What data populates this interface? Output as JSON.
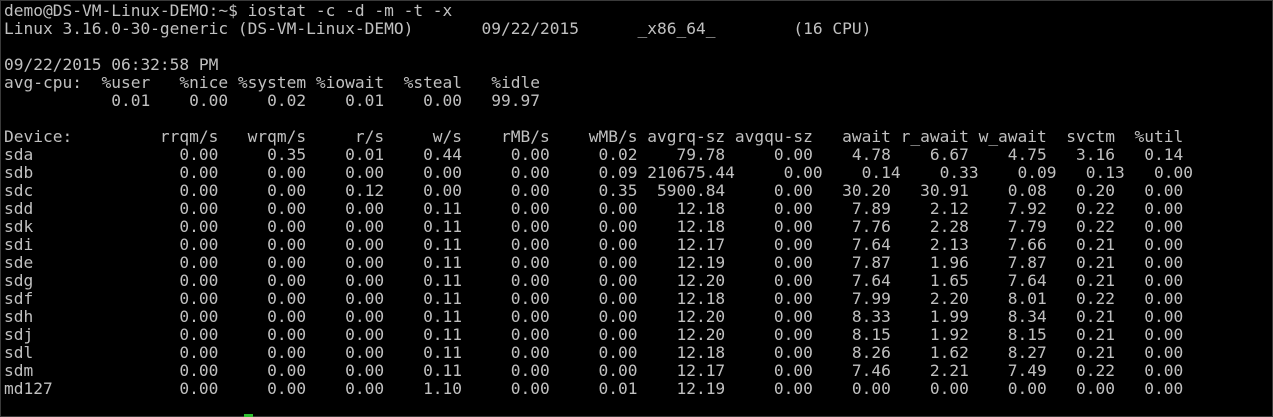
{
  "terminal": {
    "lines": [
      "demo@DS-VM-Linux-DEMO:~$ iostat -c -d -m -t -x",
      "Linux 3.16.0-30-generic (DS-VM-Linux-DEMO)       09/22/2015      _x86_64_        (16 CPU)",
      "",
      "09/22/2015 06:32:58 PM",
      "avg-cpu:  %user   %nice %system %iowait  %steal   %idle",
      "           0.01    0.00    0.02    0.01    0.00   99.97",
      "",
      "Device:         rrqm/s   wrqm/s     r/s     w/s    rMB/s    wMB/s avgrq-sz avgqu-sz   await r_await w_await  svctm  %util",
      "sda               0.00     0.35    0.01    0.44     0.00     0.02    79.78     0.00    4.78    6.67    4.75   3.16   0.14",
      "sdb               0.00     0.00    0.00    0.00     0.00     0.09 210675.44     0.00    0.14    0.33    0.09   0.13   0.00",
      "sdc               0.00     0.00    0.12    0.00     0.00     0.35  5900.84     0.00   30.20   30.91    0.08   0.20   0.00",
      "sdd               0.00     0.00    0.00    0.11     0.00     0.00    12.18     0.00    7.89    2.12    7.92   0.22   0.00",
      "sdk               0.00     0.00    0.00    0.11     0.00     0.00    12.18     0.00    7.76    2.28    7.79   0.22   0.00",
      "sdi               0.00     0.00    0.00    0.11     0.00     0.00    12.17     0.00    7.64    2.13    7.66   0.21   0.00",
      "sde               0.00     0.00    0.00    0.11     0.00     0.00    12.19     0.00    7.87    1.96    7.87   0.21   0.00",
      "sdg               0.00     0.00    0.00    0.11     0.00     0.00    12.20     0.00    7.64    1.65    7.64   0.21   0.00",
      "sdf               0.00     0.00    0.00    0.11     0.00     0.00    12.18     0.00    7.99    2.20    8.01   0.22   0.00",
      "sdh               0.00     0.00    0.00    0.11     0.00     0.00    12.20     0.00    8.33    1.99    8.34   0.21   0.00",
      "sdj               0.00     0.00    0.00    0.11     0.00     0.00    12.20     0.00    8.15    1.92    8.15   0.21   0.00",
      "sdl               0.00     0.00    0.00    0.11     0.00     0.00    12.18     0.00    8.26    1.62    8.27   0.21   0.00",
      "sdm               0.00     0.00    0.00    0.11     0.00     0.00    12.17     0.00    7.46    2.21    7.49   0.22   0.00",
      "md127             0.00     0.00    0.00    1.10     0.00     0.01    12.19     0.00    0.00    0.00    0.00   0.00   0.00"
    ]
  },
  "colors": {
    "background": "#000000",
    "text": "#c0c0c0",
    "cursor": "#2fbf2f"
  }
}
